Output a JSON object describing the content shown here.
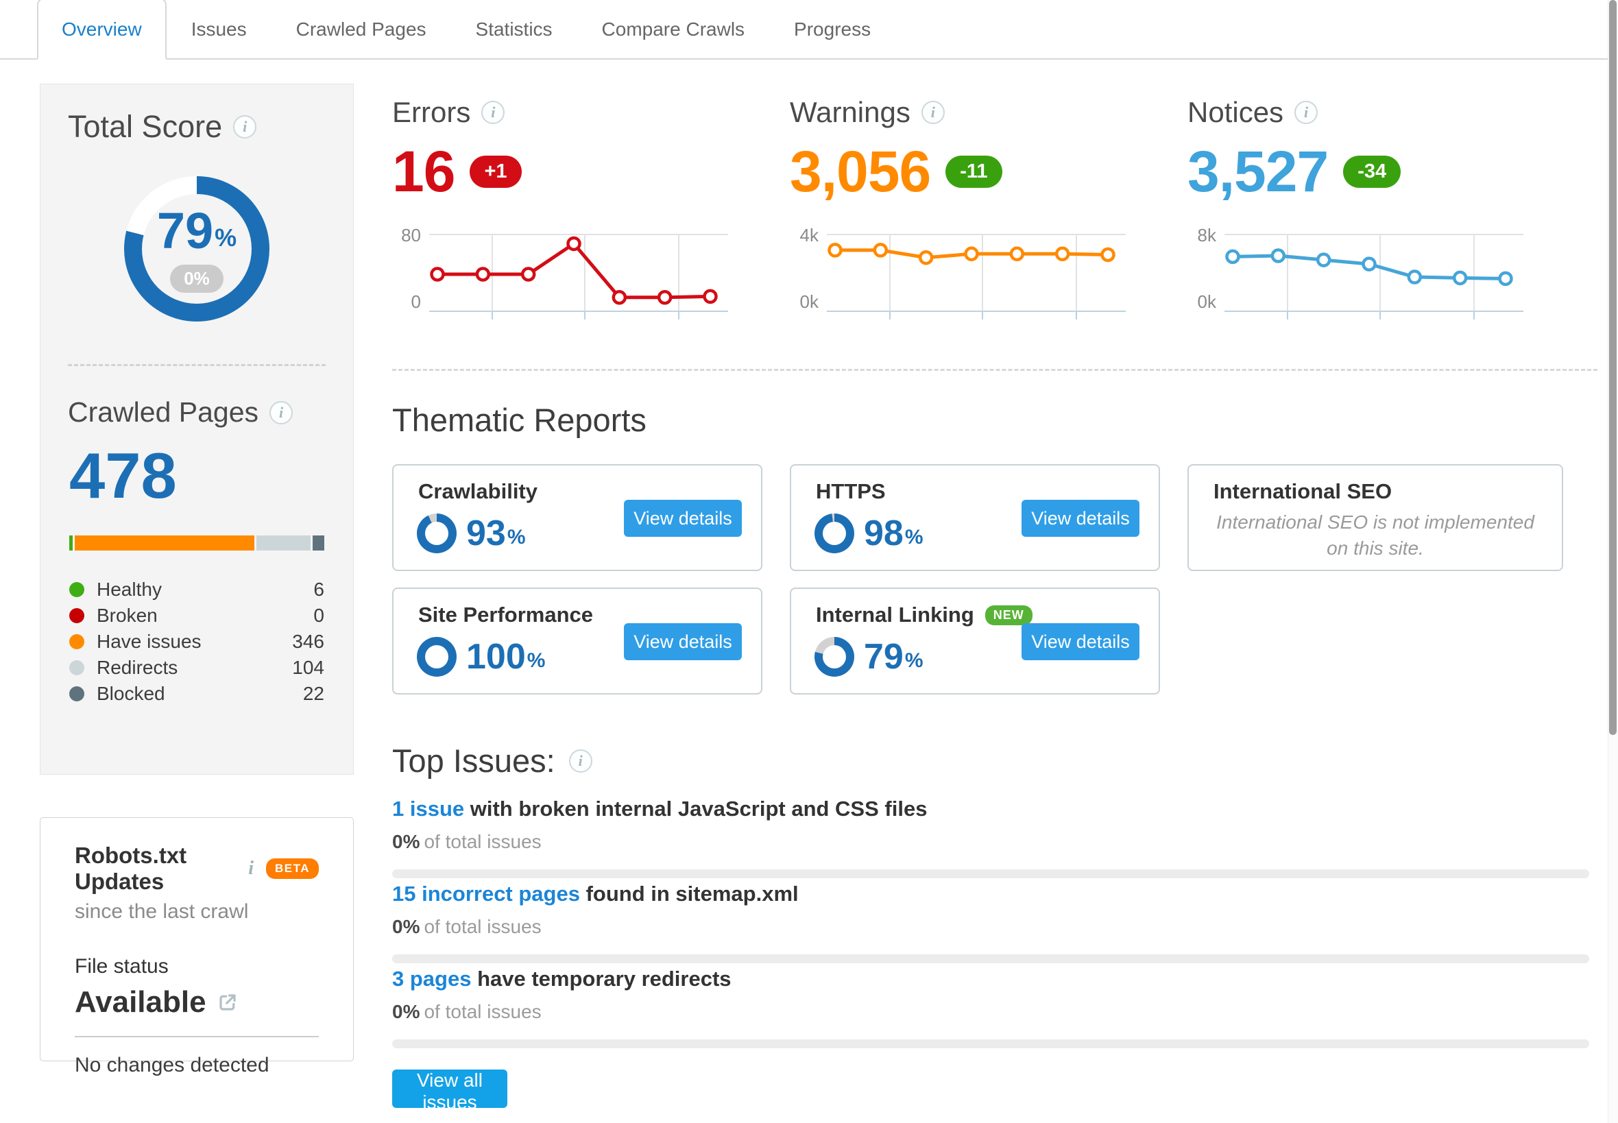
{
  "icons": {
    "info": "i"
  },
  "tabs": [
    "Overview",
    "Issues",
    "Crawled Pages",
    "Statistics",
    "Compare Crawls",
    "Progress"
  ],
  "total_score": {
    "title": "Total Score",
    "value": "79",
    "unit": "%",
    "delta": "0%",
    "donut": {
      "pct": 79,
      "color": "#1c6fb5",
      "track": "#ffffff"
    }
  },
  "crawled_pages": {
    "title": "Crawled Pages",
    "total": "478",
    "legend": [
      {
        "label": "Healthy",
        "value": "6",
        "color": "#3fae14"
      },
      {
        "label": "Broken",
        "value": "0",
        "color": "#c60000"
      },
      {
        "label": "Have issues",
        "value": "346",
        "color": "#ff8a00"
      },
      {
        "label": "Redirects",
        "value": "104",
        "color": "#ccd6d9"
      },
      {
        "label": "Blocked",
        "value": "22",
        "color": "#5e737e"
      }
    ]
  },
  "robots": {
    "title": "Robots.txt Updates",
    "beta_badge": "BETA",
    "subtitle": "since the last crawl",
    "file_status_label": "File status",
    "file_status_value": "Available",
    "note": "No changes detected"
  },
  "metrics": [
    {
      "title": "Errors",
      "value": "16",
      "badge": "+1",
      "color": "#d30d15",
      "badge_bg": "#d30d15"
    },
    {
      "title": "Warnings",
      "value": "3,056",
      "badge": "-11",
      "color": "#ff8a00",
      "badge_bg": "#3aa10e"
    },
    {
      "title": "Notices",
      "value": "3,527",
      "badge": "-34",
      "color": "#3fa3dc",
      "badge_bg": "#3aa10e"
    }
  ],
  "chart_data": [
    {
      "type": "line",
      "name": "Errors trend",
      "color": "#d30d15",
      "ymax": 80,
      "ymin": 0,
      "ymax_label": "80",
      "ymin_label": "0",
      "grid": true,
      "values": [
        40,
        40,
        40,
        73,
        15,
        15,
        16
      ]
    },
    {
      "type": "line",
      "name": "Warnings trend",
      "color": "#ff8a00",
      "ymax": 4000,
      "ymin": 0,
      "ymax_label": "4k",
      "ymin_label": "0k",
      "grid": true,
      "values": [
        3300,
        3300,
        2900,
        3100,
        3100,
        3100,
        3056
      ]
    },
    {
      "type": "line",
      "name": "Notices trend",
      "color": "#46a5d8",
      "ymax": 8000,
      "ymin": 0,
      "ymax_label": "8k",
      "ymin_label": "0k",
      "grid": true,
      "values": [
        5900,
        6000,
        5550,
        5100,
        3700,
        3600,
        3527
      ]
    }
  ],
  "thematic": {
    "title": "Thematic Reports",
    "view_details_label": "View details",
    "percent_sign": "%",
    "cards": [
      {
        "title": "Crawlability",
        "score": "93",
        "donut": {
          "pct": 93,
          "color": "#1c6fb5",
          "track": "#d2d2d2"
        }
      },
      {
        "title": "HTTPS",
        "score": "98",
        "donut": {
          "pct": 98,
          "color": "#1c6fb5",
          "track": "#d2d2d2"
        }
      },
      {
        "title": "International SEO",
        "note": "International SEO is not implemented on this site."
      },
      {
        "title": "Site Performance",
        "score": "100",
        "donut": {
          "pct": 100,
          "color": "#1c6fb5",
          "track": "#d2d2d2"
        }
      },
      {
        "title": "Internal Linking",
        "badge": "NEW",
        "score": "79",
        "donut": {
          "pct": 79,
          "color": "#1c6fb5",
          "track": "#d2d2d2"
        }
      }
    ]
  },
  "top_issues": {
    "title": "Top Issues:",
    "items": [
      {
        "link": "1 issue",
        "text": "with broken internal JavaScript and CSS files",
        "pct": "0%",
        "suffix": "of total issues",
        "fill": "0%"
      },
      {
        "link": "15 incorrect pages",
        "text": "found in sitemap.xml",
        "pct": "0%",
        "suffix": "of total issues",
        "fill": "0%"
      },
      {
        "link": "3 pages",
        "text": "have temporary redirects",
        "pct": "0%",
        "suffix": "of total issues",
        "fill": "0%"
      }
    ],
    "view_all_label": "View all issues"
  }
}
